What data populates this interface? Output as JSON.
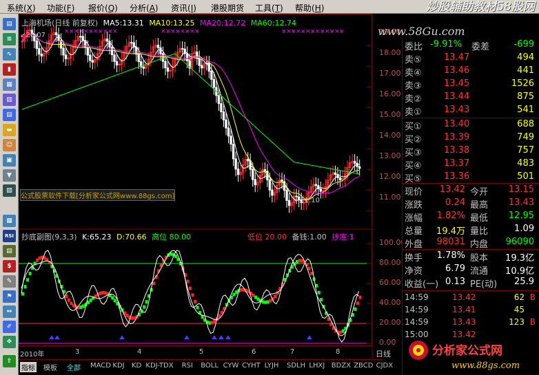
{
  "menu": [
    {
      "label": "系统",
      "key": "X"
    },
    {
      "label": "功能",
      "key": "F"
    },
    {
      "label": "报价",
      "key": "Q"
    },
    {
      "label": "分析",
      "key": "A"
    },
    {
      "label": "资讯",
      "key": "I"
    },
    {
      "label": "港股期货",
      "key": ""
    },
    {
      "label": "工具",
      "key": "T"
    },
    {
      "label": "帮助",
      "key": "H"
    }
  ],
  "watermark": {
    "top": "炒股辅助教材58股网",
    "url": "www.58Gu.com",
    "bottom_brand": "分析家公式网",
    "bottom_url": "www.88gs.com"
  },
  "main_header": {
    "title": "上海机场(日线 前复权)",
    "ma5": "MA5:13.31",
    "ma10": "MA10:13.25",
    "ma20": "MA20:12.72",
    "ma60": "MA60:12.74"
  },
  "main_labels": {
    "high": "20.07",
    "low": "←11.10",
    "ad_text": "公式股票软件下载[分析家公式网www.88gs.com]"
  },
  "sub_header": {
    "title": "抄底副图(9,3,3)",
    "k": "K:65.23",
    "d": "D:70.66",
    "high": "高位 80.00",
    "low": "低位 20.00",
    "ready": "备钱:1.00",
    "bottom": "抄底:1"
  },
  "x_labels": [
    "2010年",
    "3",
    "4",
    "5",
    "6",
    "7",
    "8"
  ],
  "period": "日线",
  "y_main": [
    "19.00",
    "18.00",
    "17.00",
    "16.00",
    "15.00",
    "14.00",
    "13.00",
    "12.00",
    "11.00"
  ],
  "y_sub": [
    "100.00",
    "80.00",
    "60.00",
    "40.00",
    "20.00",
    "0.00"
  ],
  "quote": {
    "ratio_label": "委比",
    "ratio_value": "-9.91%",
    "diff_label": "委差",
    "diff_value": "-699",
    "sells": [
      {
        "label": "卖⑤",
        "price": "13.47",
        "vol": "494"
      },
      {
        "label": "卖④",
        "price": "13.46",
        "vol": "441"
      },
      {
        "label": "卖③",
        "price": "13.45",
        "vol": "1526"
      },
      {
        "label": "卖②",
        "price": "13.44",
        "vol": "875"
      },
      {
        "label": "卖①",
        "price": "13.43",
        "vol": "541"
      }
    ],
    "buys": [
      {
        "label": "买①",
        "price": "13.40",
        "vol": "688"
      },
      {
        "label": "买②",
        "price": "13.39",
        "vol": "749"
      },
      {
        "label": "买③",
        "price": "13.38",
        "vol": "757"
      },
      {
        "label": "买④",
        "price": "13.37",
        "vol": "483"
      },
      {
        "label": "买⑤",
        "price": "13.36",
        "vol": "501"
      }
    ],
    "stats": [
      {
        "l1": "现价",
        "v1": "13.42",
        "l2": "今开",
        "v2": "13.15"
      },
      {
        "l1": "涨跌",
        "v1": "0.24",
        "l2": "最高",
        "v2": "13.43"
      },
      {
        "l1": "涨幅",
        "v1": "1.82%",
        "l2": "最低",
        "v2": "12.95"
      },
      {
        "l1": "总量",
        "v1": "19.4万",
        "l2": "量比",
        "v2": "1.09"
      },
      {
        "l1": "外盘",
        "v1": "98031",
        "l2": "内盘",
        "v2": "96090"
      }
    ],
    "finance": [
      {
        "l1": "换手",
        "v1": "1.78%",
        "l2": "股本",
        "v2": "19.3亿"
      },
      {
        "l1": "净资",
        "v1": "6.79",
        "l2": "流通",
        "v2": "10.9亿"
      },
      {
        "l1": "收益(一)",
        "v1": "0.13",
        "l2": "PE(动)",
        "v2": "25.9"
      }
    ],
    "ticks": [
      {
        "time": "14:59",
        "price": "13.42",
        "vol": "62",
        "dir": "B"
      },
      {
        "time": "14:59",
        "price": "13.41",
        "vol": "45",
        "dir": ""
      },
      {
        "time": "14:59",
        "price": "13.43",
        "vol": "123",
        "dir": "B"
      },
      {
        "time": "15:00",
        "price": "13.42",
        "vol": "",
        "dir": ""
      }
    ]
  },
  "tabs": [
    "指标",
    "模板",
    "全部",
    "MACD",
    "KDJ",
    "KD",
    "KDJ-TDX",
    "RSI",
    "BOLL",
    "CYW",
    "CYHT",
    "LYJH",
    "SDLH",
    "LHXJ",
    "BDZX",
    "ZBCD",
    "CJDX"
  ],
  "colors": {
    "up": "#ff3232",
    "down": "#00ffff",
    "ma5": "#ffffff",
    "ma10": "#ffff00",
    "ma20": "#ff00ff",
    "ma60": "#00ff00",
    "axis": "#800000"
  }
}
